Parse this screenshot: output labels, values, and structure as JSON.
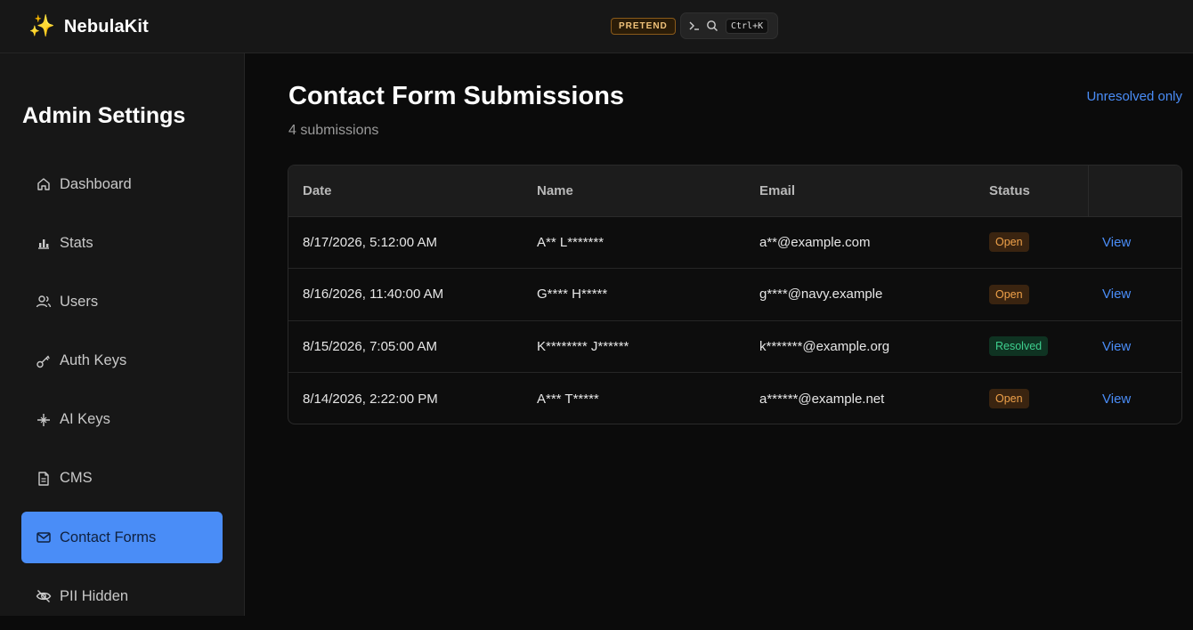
{
  "app": {
    "brand_icon": "sparkles-icon",
    "brand_name": "NebulaKit",
    "mode_badge": "PRETEND",
    "command_shortcut": "Ctrl+K"
  },
  "sidebar": {
    "title": "Admin Settings",
    "items": [
      {
        "label": "Dashboard",
        "icon": "home-icon",
        "active": false
      },
      {
        "label": "Stats",
        "icon": "bar-chart-icon",
        "active": false
      },
      {
        "label": "Users",
        "icon": "users-icon",
        "active": false
      },
      {
        "label": "Auth Keys",
        "icon": "key-icon",
        "active": false
      },
      {
        "label": "AI Keys",
        "icon": "sparkle-icon",
        "active": false
      },
      {
        "label": "CMS",
        "icon": "document-icon",
        "active": false
      },
      {
        "label": "Contact Forms",
        "icon": "mail-icon",
        "active": true
      },
      {
        "label": "PII Hidden",
        "icon": "eye-off-icon",
        "active": false
      }
    ]
  },
  "main": {
    "title": "Contact Form Submissions",
    "subtitle": "4 submissions",
    "filter_link": "Unresolved only",
    "table": {
      "headers": [
        "Date",
        "Name",
        "Email",
        "Status",
        ""
      ],
      "rows": [
        {
          "date": "8/17/2026, 5:12:00 AM",
          "name": "A** L*******",
          "email": "a**@example.com",
          "status": "Open",
          "action": "View"
        },
        {
          "date": "8/16/2026, 11:40:00 AM",
          "name": "G**** H*****",
          "email": "g****@navy.example",
          "status": "Open",
          "action": "View"
        },
        {
          "date": "8/15/2026, 7:05:00 AM",
          "name": "K******** J******",
          "email": "k*******@example.org",
          "status": "Resolved",
          "action": "View"
        },
        {
          "date": "8/14/2026, 2:22:00 PM",
          "name": "A*** T*****",
          "email": "a******@example.net",
          "status": "Open",
          "action": "View"
        }
      ]
    }
  },
  "colors": {
    "accent": "#4a8df7",
    "open_status": "#f0a24a",
    "resolved_status": "#3ecf8e",
    "background": "#0b0b0b"
  }
}
